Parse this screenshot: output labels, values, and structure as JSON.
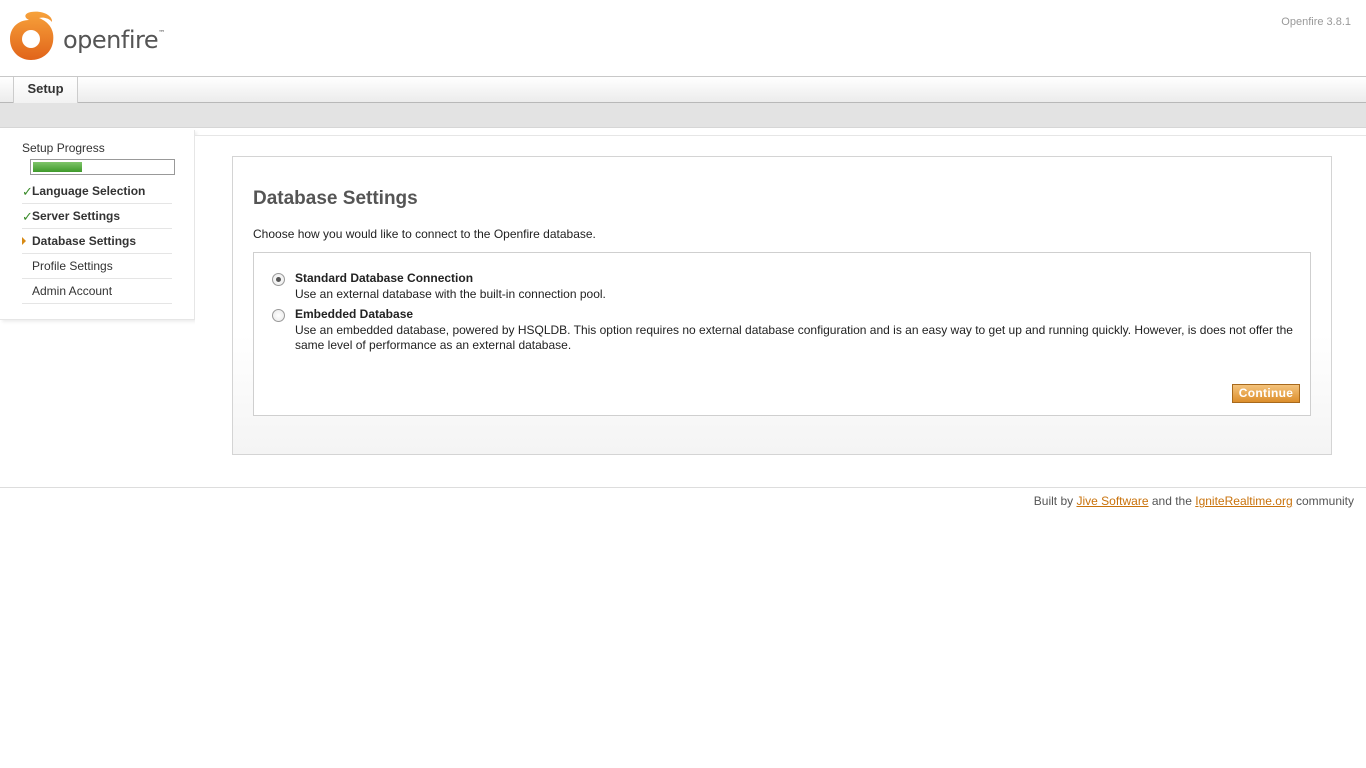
{
  "header": {
    "logo_text": "openfire",
    "logo_tm": "™",
    "version": "Openfire 3.8.1"
  },
  "tabs": [
    {
      "label": "Setup"
    }
  ],
  "sidebar": {
    "progress_label": "Setup Progress",
    "progress_fraction": 0.35,
    "steps": [
      {
        "label": "Language Selection",
        "status": "done"
      },
      {
        "label": "Server Settings",
        "status": "done"
      },
      {
        "label": "Database Settings",
        "status": "current"
      },
      {
        "label": "Profile Settings",
        "status": "pending"
      },
      {
        "label": "Admin Account",
        "status": "pending"
      }
    ]
  },
  "main": {
    "title": "Database Settings",
    "description": "Choose how you would like to connect to the Openfire database.",
    "options": [
      {
        "title": "Standard Database Connection",
        "description": "Use an external database with the built-in connection pool.",
        "selected": true
      },
      {
        "title": "Embedded Database",
        "description": "Use an embedded database, powered by HSQLDB. This option requires no external database configuration and is an easy way to get up and running quickly. However, is does not offer the same level of performance as an external database.",
        "selected": false
      }
    ],
    "continue_label": "Continue"
  },
  "footer": {
    "prefix": "Built by",
    "link1": "Jive Software",
    "middle": "and the",
    "link2": "IgniteRealtime.org",
    "suffix": "community"
  },
  "colors": {
    "accent": "#dc8e2c",
    "progress": "#3e9a2a",
    "link": "#c9720b"
  }
}
